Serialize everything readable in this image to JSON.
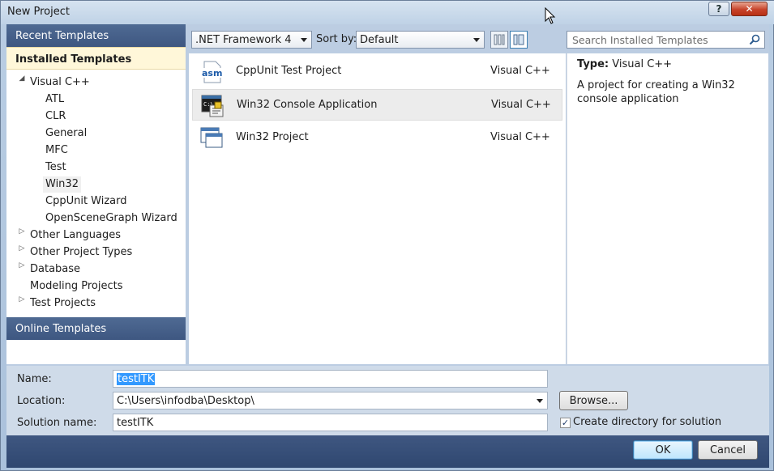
{
  "window": {
    "title": "New Project",
    "help_label": "?",
    "close_label": "✕"
  },
  "left": {
    "recent_templates": "Recent Templates",
    "installed_templates": "Installed Templates",
    "online_templates": "Online Templates",
    "tree": [
      {
        "label": "Visual C++",
        "expander": "◢"
      },
      {
        "label": "ATL"
      },
      {
        "label": "CLR"
      },
      {
        "label": "General"
      },
      {
        "label": "MFC"
      },
      {
        "label": "Test"
      },
      {
        "label": "Win32"
      },
      {
        "label": "CppUnit Wizard"
      },
      {
        "label": "OpenSceneGraph Wizard"
      },
      {
        "label": "Other Languages",
        "expander": "▷"
      },
      {
        "label": "Other Project Types",
        "expander": "▷"
      },
      {
        "label": "Database",
        "expander": "▷"
      },
      {
        "label": "Modeling Projects"
      },
      {
        "label": "Test Projects",
        "expander": "▷"
      }
    ]
  },
  "toolbar": {
    "framework": ".NET Framework 4",
    "sort_by_label": "Sort by:",
    "sort_value": "Default",
    "search_placeholder": "Search Installed Templates"
  },
  "templates": [
    {
      "name": "CppUnit Test Project",
      "language": "Visual C++",
      "icon": "asm-icon",
      "icon_text": "asm"
    },
    {
      "name": "Win32 Console Application",
      "language": "Visual C++",
      "icon": "console-app-icon",
      "icon_text": "C:\\"
    },
    {
      "name": "Win32 Project",
      "language": "Visual C++",
      "icon": "win32-project-icon"
    }
  ],
  "details": {
    "type_label": "Type:",
    "type_value": "Visual C++",
    "description": "A project for creating a Win32 console application"
  },
  "form": {
    "name_label": "Name:",
    "name_value": "testITK",
    "location_label": "Location:",
    "location_value": "C:\\Users\\infodba\\Desktop\\",
    "solution_label": "Solution name:",
    "solution_value": "testITK",
    "browse_label": "Browse...",
    "create_dir_label": "Create directory for solution",
    "create_dir_checked": "✓"
  },
  "footer": {
    "ok_label": "OK",
    "cancel_label": "Cancel"
  },
  "colors": {
    "header_blue": "#3e5781",
    "installed_highlight": "#fff7d9",
    "selection_blue": "#3399ff"
  }
}
